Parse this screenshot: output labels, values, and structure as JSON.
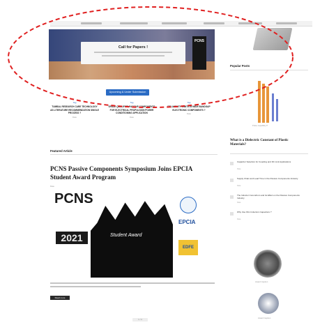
{
  "hero": {
    "heading": "Call for Papers !",
    "logo_text": "PCNS"
  },
  "cta": {
    "label": "Upcoming & Under Submission"
  },
  "news": [
    {
      "tag": "Tag",
      "title": "TUMBAL RESEARCH CARE TECHNOLOGY AS LITERATURE RECOMMENDATION SINGLE PROCESS ?",
      "date": "Date"
    },
    {
      "tag": "Tag",
      "title": "SPACE QUALIFIED PASSIVE COMPONENTS FOR ELECTRICAL PROPULSION POWER CONDITIONING APPLICATION",
      "date": "Date"
    },
    {
      "tag": "Tag",
      "title": "RELIABILITY LIMITS IN WIDE BANDGAP ELECTRONIC COMPONENTS ?",
      "date": "Date"
    }
  ],
  "featured": {
    "section_label": "Featured Article",
    "title": "PCNS Passive Components Symposium Joins EPCIA Student Award Program",
    "meta": "Date",
    "read_more": "Read more"
  },
  "award_image": {
    "logo_text": "PCNS",
    "year": "2021",
    "caption": "Student Award",
    "partner_1": "EPCIA",
    "partner_2": "EDFE"
  },
  "sidebar": {
    "popular_heading": "Popular Posts",
    "chart_caption": "Pulse capability P",
    "question_title": "What is a Dielectric Constant of Plastic Materials?",
    "related": [
      {
        "title": "Capacitor Selection for Coupling and DC Link Applications",
        "date": "Date"
      },
      {
        "title": "Supply Chain and Lead Time in the Passive Components Industry",
        "date": "Date"
      },
      {
        "title": "The Inductor Conundrum and its Effect on the Passive Components Industry",
        "date": "Date"
      },
      {
        "title": "Why Use Film Inductors Capacitors ?",
        "date": "Date"
      }
    ],
    "badge_1_caption": "Award Caption",
    "badge_2_caption": "Award Caption"
  },
  "pager": {
    "label": "1 / 2"
  },
  "colors": {
    "accent": "#2a6bc4",
    "highlight": "#e02020"
  }
}
